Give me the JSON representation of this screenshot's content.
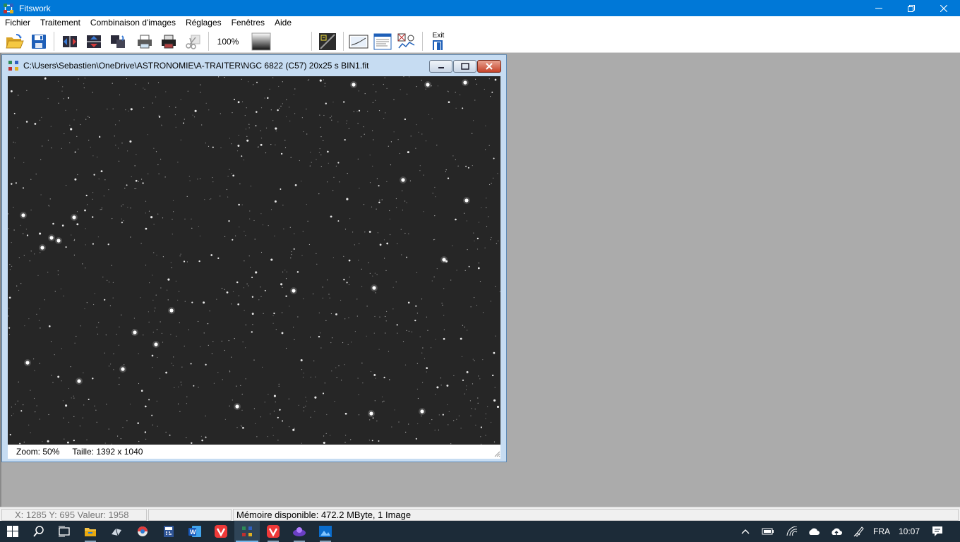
{
  "window": {
    "title": "Fitswork",
    "icons": {
      "app": "fitswork-app-icon",
      "minimize": "minimize-icon",
      "restore": "restore-icon",
      "close": "close-icon"
    }
  },
  "menu": {
    "items": [
      {
        "label": "Fichier"
      },
      {
        "label": "Traitement"
      },
      {
        "label": "Combinaison d'images"
      },
      {
        "label": "Réglages"
      },
      {
        "label": "Fenêtres"
      },
      {
        "label": "Aide"
      }
    ]
  },
  "toolbar": {
    "zoom_label": "100%",
    "exit_label": "Exit",
    "icons": [
      "open-folder-icon",
      "save-icon",
      "flip-horizontal-icon",
      "flip-vertical-icon",
      "rotate-icon",
      "print-icon",
      "print-dark-icon",
      "scissors-icon",
      "zoom-100-icon",
      "gradient-icon",
      "histogram-icon",
      "graph-icon",
      "header-icon",
      "analysis-icon",
      "exit-icon"
    ]
  },
  "image_window": {
    "caption": "C:\\Users\\Sebastien\\OneDrive\\ASTRONOMIE\\A-TRAITER\\NGC 6822 (C57) 20x25 s BIN1.fit",
    "zoom": "Zoom: 50%",
    "size": "Taille: 1392 x 1040",
    "image_name": "starfield-image"
  },
  "statusbar": {
    "coords": "X: 1285  Y: 695  Valeur: 1958",
    "empty": "",
    "memory": "Mémoire disponible: 472.2 MByte, 1 Image"
  },
  "taskbar": {
    "language": "FRA",
    "clock": "10:07",
    "icons": [
      "windows-start-icon",
      "search-icon",
      "task-view-icon",
      "file-explorer-icon",
      "app-icon",
      "colorful-app-icon",
      "calculator-icon",
      "word-icon",
      "vivaldi-icon",
      "fitswork-taskbar-icon",
      "vivaldi-taskbar-icon",
      "purple-app-icon",
      "photos-icon"
    ],
    "tray_icons": [
      "chevron-up-icon",
      "battery-icon",
      "wifi-icon",
      "onedrive-icon",
      "cloud-upload-icon",
      "pen-icon",
      "notification-icon"
    ]
  },
  "colors": {
    "titlebar": "#0078d7",
    "mdi_background": "#ababab",
    "image_background": "#262626",
    "taskbar": "#1c2b38"
  }
}
